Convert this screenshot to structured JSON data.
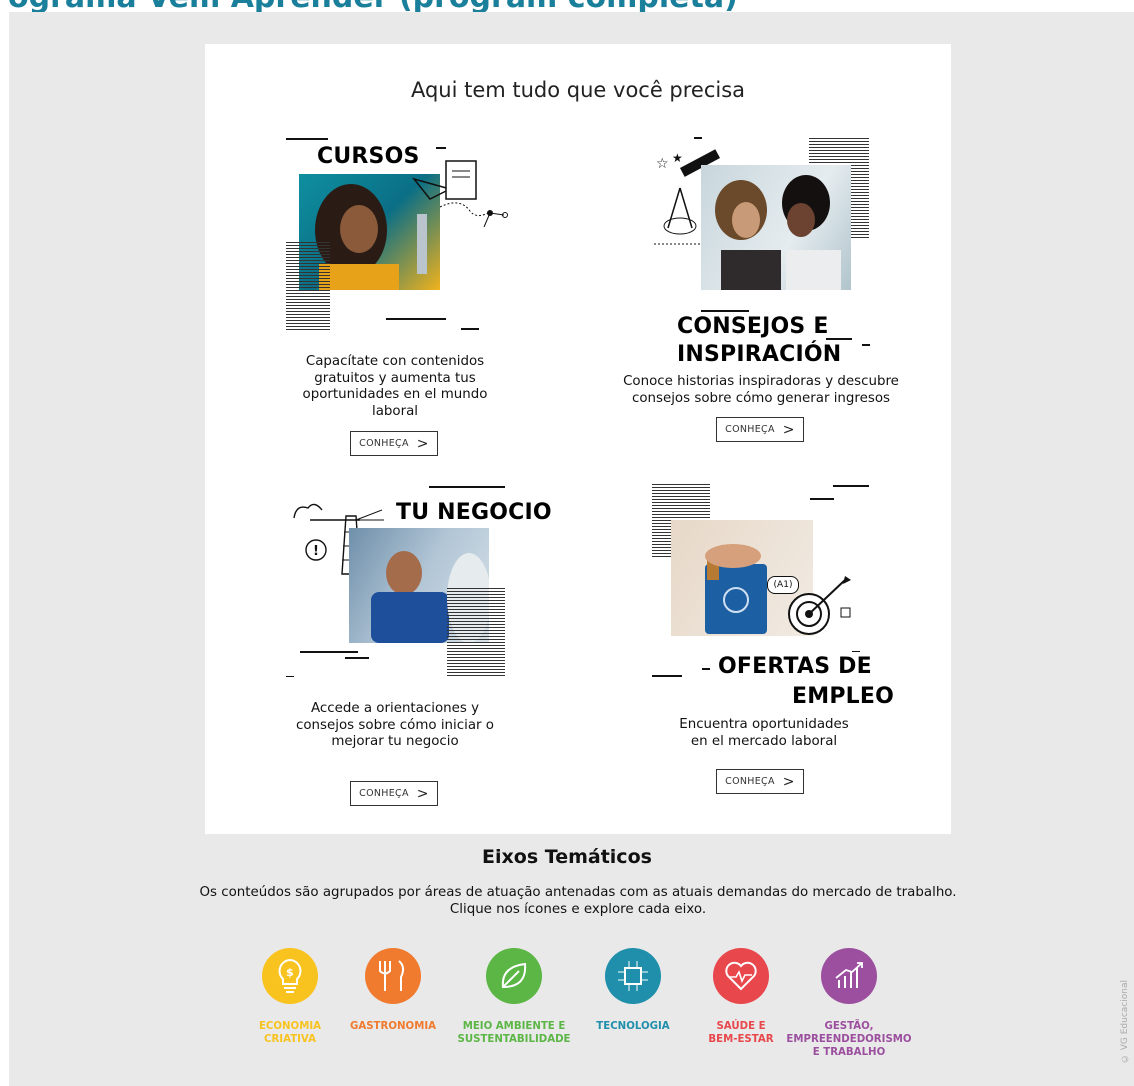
{
  "header": {
    "title": "ograma Vem Aprender (program completa)"
  },
  "card_title": "Aqui tem tudo que você precisa",
  "tiles": [
    {
      "title": "CURSOS",
      "desc": "Capacítate con contenidos gratuitos y aumenta tus oportunidades en el mundo laboral",
      "button": "CONHEÇA"
    },
    {
      "title_line1": "CONSEJOS E",
      "title_line2": "INSPIRACIÓN",
      "desc": "Conoce historias inspiradoras y descubre consejos sobre cómo generar ingresos",
      "button": "CONHEÇA"
    },
    {
      "title": "TU NEGOCIO",
      "desc": "Accede a orientaciones y consejos sobre cómo iniciar o mejorar tu negocio",
      "button": "CONHEÇA"
    },
    {
      "title_line1": "OFERTAS DE",
      "title_line2": "EMPLEO",
      "desc": "Encuentra oportunidades en el mercado laboral",
      "button": "CONHEÇA",
      "tag": "(A1)"
    }
  ],
  "eixos": {
    "title": "Eixos Temáticos",
    "desc_line1": "Os conteúdos são agrupados por áreas de atuação antenadas com as atuais demandas do mercado de trabalho.",
    "desc_line2": "Clique nos ícones e explore cada eixo.",
    "items": [
      {
        "label_1": "ECONOMIA",
        "label_2": "CRIATIVA",
        "color": "#f9c31f",
        "icon": "lightbulb-dollar-icon"
      },
      {
        "label_1": "GASTRONOMIA",
        "label_2": "",
        "color": "#f07a2e",
        "icon": "fork-knife-icon"
      },
      {
        "label_1": "MEIO AMBIENTE E",
        "label_2": "SUSTENTABILIDADE",
        "color": "#5cb646",
        "icon": "leaf-icon"
      },
      {
        "label_1": "TECNOLOGIA",
        "label_2": "",
        "color": "#1f8fab",
        "icon": "circuit-chip-icon"
      },
      {
        "label_1": "SAÚDE E",
        "label_2": "BEM-ESTAR",
        "color": "#e8474c",
        "icon": "heart-pulse-icon"
      },
      {
        "label_1": "GESTÃO,",
        "label_2": "EMPREENDEDORISMO",
        "label_3": "E TRABALHO",
        "color": "#9b4f9e",
        "icon": "chart-growth-icon"
      }
    ]
  },
  "credit": "© VG Educacional"
}
